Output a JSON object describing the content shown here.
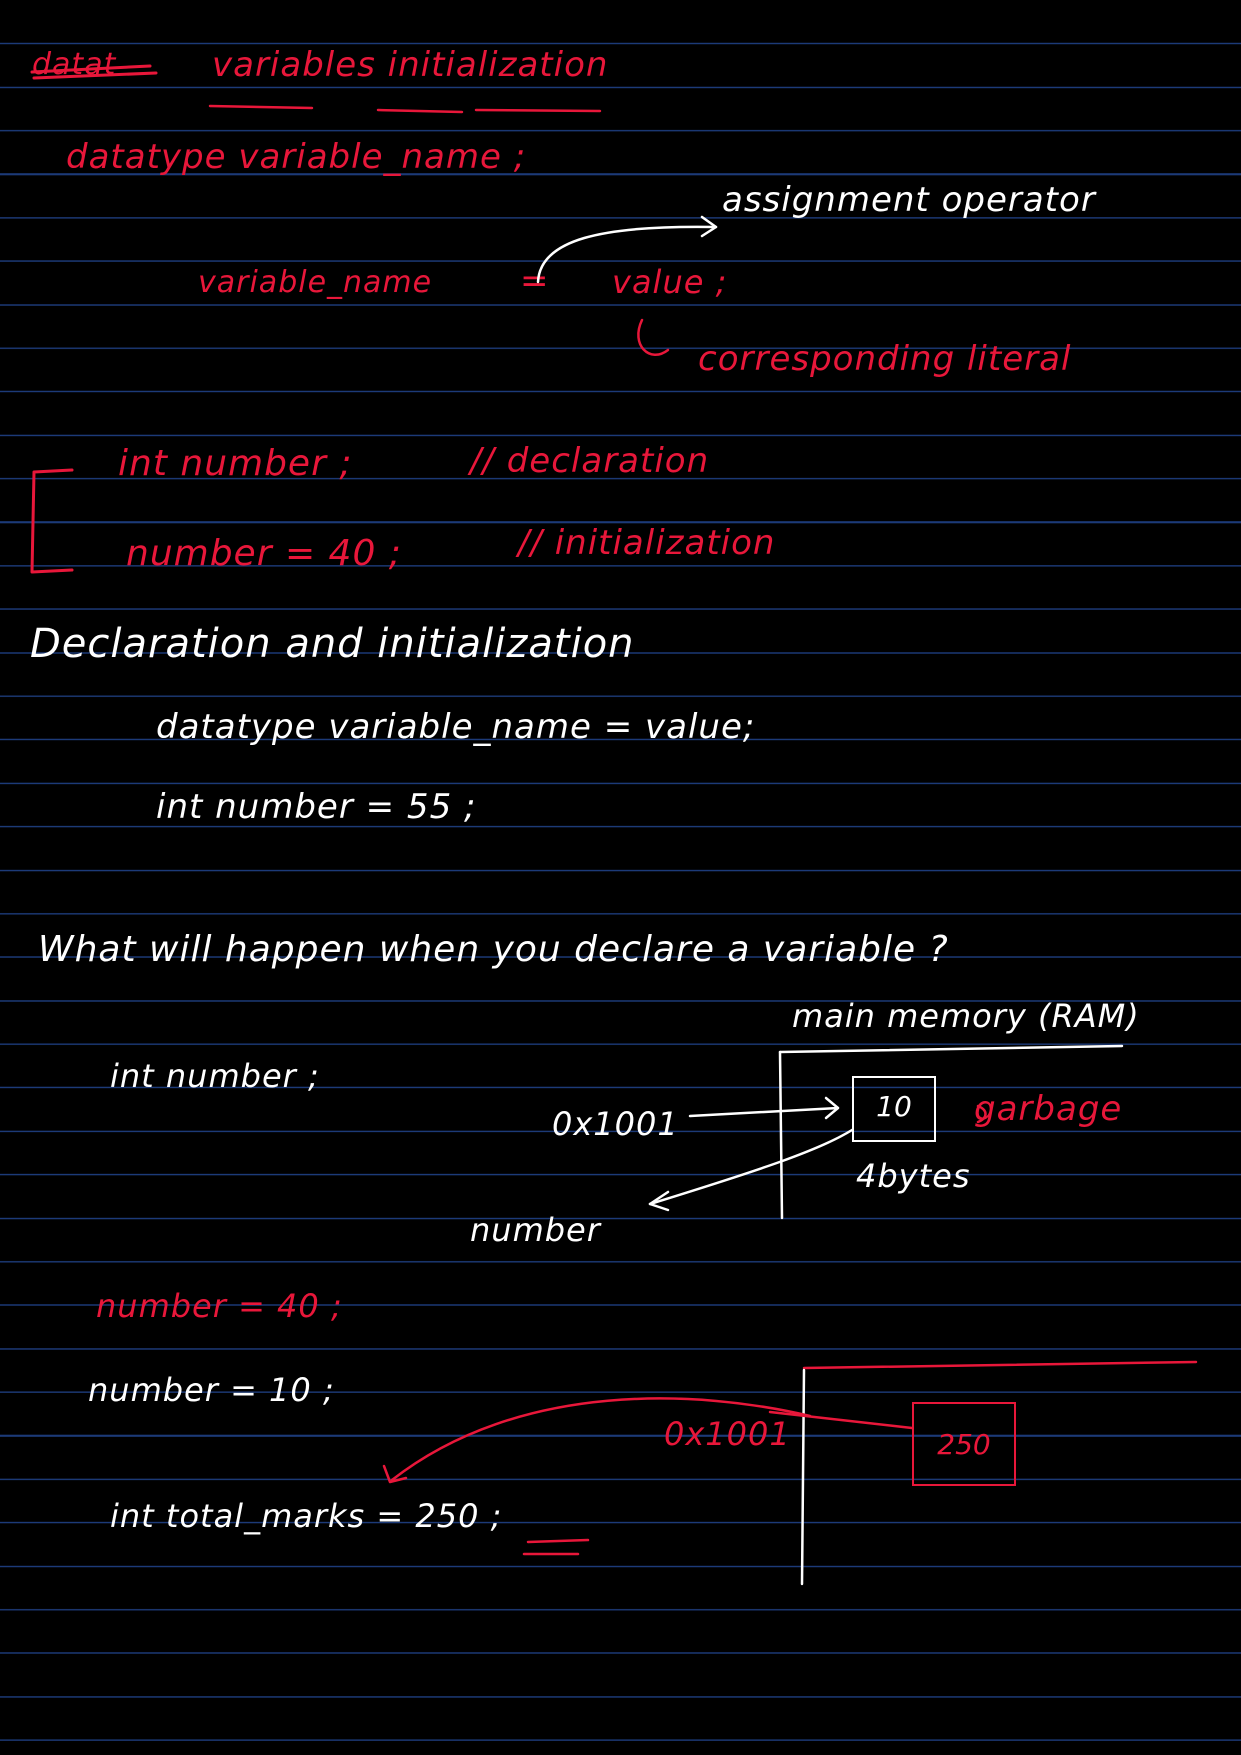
{
  "colors": {
    "background": "#000000",
    "rule_line": "#1c3a78",
    "red_ink": "#e8173a",
    "white_ink": "#ffffff"
  },
  "heading": {
    "struck": "datat",
    "title": "variables initialization"
  },
  "syntax": {
    "declaration": "datatype   variable_name  ;",
    "assignment_lhs": "variable_name",
    "equals": "=",
    "assignment_rhs": "value ;",
    "assignment_operator_label": "assignment operator",
    "literal_label": "corresponding literal"
  },
  "example": {
    "line1_code": "int  number ;",
    "line1_comment": "// declaration",
    "line2_code": "number  =  40 ;",
    "line2_comment": "// initialization"
  },
  "combined": {
    "heading": "Declaration  and  initialization",
    "syntax": "datatype   variable_name   =   value;",
    "example": "int   number =  55 ;"
  },
  "memory": {
    "question": "What will happen when you declare a variable ?",
    "decl_code": "int  number  ;",
    "ram_label": "main memory (RAM)",
    "address": "0x1001",
    "cell_value": "10",
    "garbage_label": "garbage",
    "size_label": "4bytes",
    "var_label": "number",
    "assign_40": "number  = 40 ;",
    "assign_10": "number = 10 ;",
    "address2": "0x1001",
    "cell2_value": "250",
    "total_code": "int  total_marks  =  250 ;"
  }
}
